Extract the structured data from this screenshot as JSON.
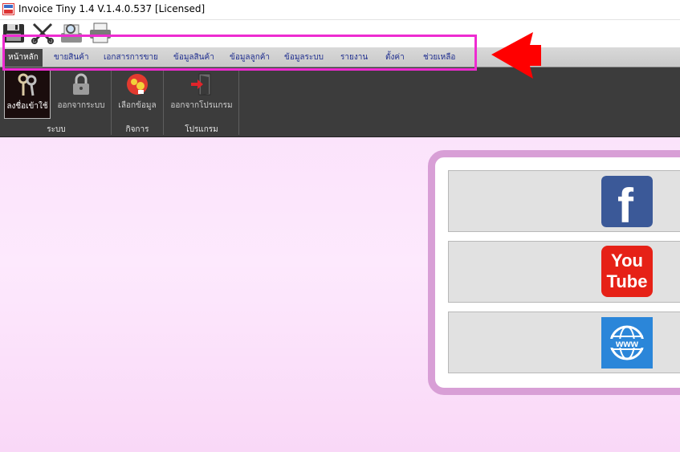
{
  "window": {
    "title": "Invoice Tiny 1.4  V.1.4.0.537 [Licensed]",
    "icon": "invoice-tiny-app-icon"
  },
  "quick_access": [
    {
      "name": "save-icon"
    },
    {
      "name": "cut-icon"
    },
    {
      "name": "print-preview-icon"
    },
    {
      "name": "printer-icon"
    }
  ],
  "menu": {
    "tabs": [
      {
        "label": "หน้าหลัก",
        "active": true
      },
      {
        "label": "ขายสินค้า"
      },
      {
        "label": "เอกสารการขาย"
      },
      {
        "label": "ข้อมูลสินค้า"
      },
      {
        "label": "ข้อมูลลูกค้า"
      },
      {
        "label": "ข้อมูลระบบ"
      },
      {
        "label": "รายงาน"
      },
      {
        "label": "ตั้งค่า"
      },
      {
        "label": "ช่วยเหลือ"
      }
    ]
  },
  "ribbon": {
    "groups": [
      {
        "label": "ระบบ",
        "buttons": [
          {
            "label": "ลงชื่อเข้าใช้",
            "icon": "keys-icon",
            "selected": true
          },
          {
            "label": "ออกจากระบบ",
            "icon": "padlock-icon"
          }
        ]
      },
      {
        "label": "กิจการ",
        "buttons": [
          {
            "label": "เลือกข้อมูล",
            "icon": "business-select-icon"
          }
        ]
      },
      {
        "label": "โปรแกรม",
        "buttons": [
          {
            "label": "ออกจากโปรแกรม",
            "icon": "exit-door-icon"
          }
        ]
      }
    ]
  },
  "social_links": [
    {
      "name": "facebook",
      "icon": "facebook-icon",
      "glyph": "f",
      "color": "#3b5998"
    },
    {
      "name": "youtube",
      "icon": "youtube-icon",
      "line1": "You",
      "line2": "Tube",
      "color": "#e62117"
    },
    {
      "name": "website",
      "icon": "globe-www-icon",
      "glyph": "www",
      "color": "#2b86d9"
    }
  ],
  "annotation": {
    "highlight_color": "#ee2bd1",
    "arrow_color": "#ff0000"
  }
}
